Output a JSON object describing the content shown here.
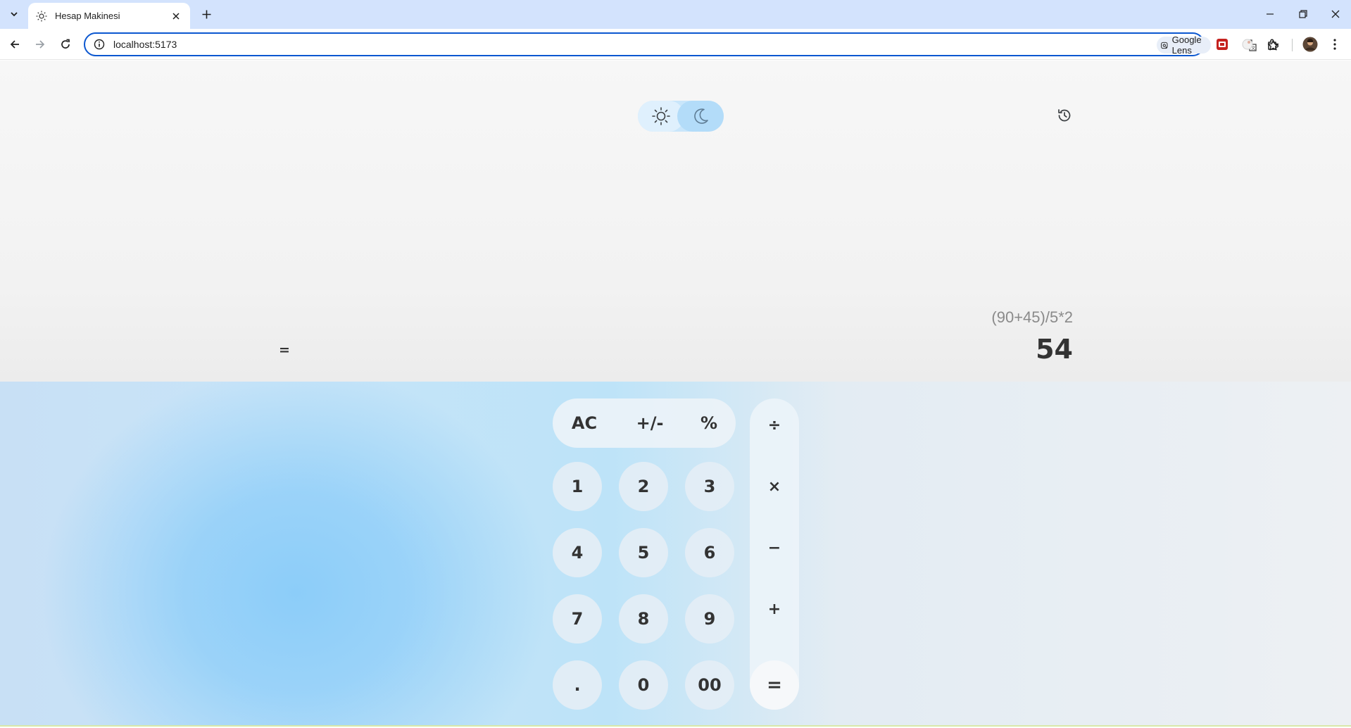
{
  "browser": {
    "tab_title": "Hesap Makinesi",
    "url": "localhost:5173",
    "lens_label": "Google Lens"
  },
  "calculator": {
    "expression": "(90+45)/5*2",
    "result": "54",
    "equals_indicator": "=",
    "function_keys": [
      "AC",
      "+/-",
      "%"
    ],
    "operator_keys": [
      "÷",
      "×",
      "−",
      "+",
      "="
    ],
    "number_rows": [
      [
        "1",
        "2",
        "3"
      ],
      [
        "4",
        "5",
        "6"
      ],
      [
        "7",
        "8",
        "9"
      ],
      [
        ".",
        "0",
        "00"
      ]
    ],
    "theme": "light"
  },
  "colors": {
    "accent": "#0b57d0",
    "titlebar": "#d3e3fd",
    "toggle": "#c9e6fb",
    "key_bg": "#e4eef5",
    "text": "#333333"
  }
}
